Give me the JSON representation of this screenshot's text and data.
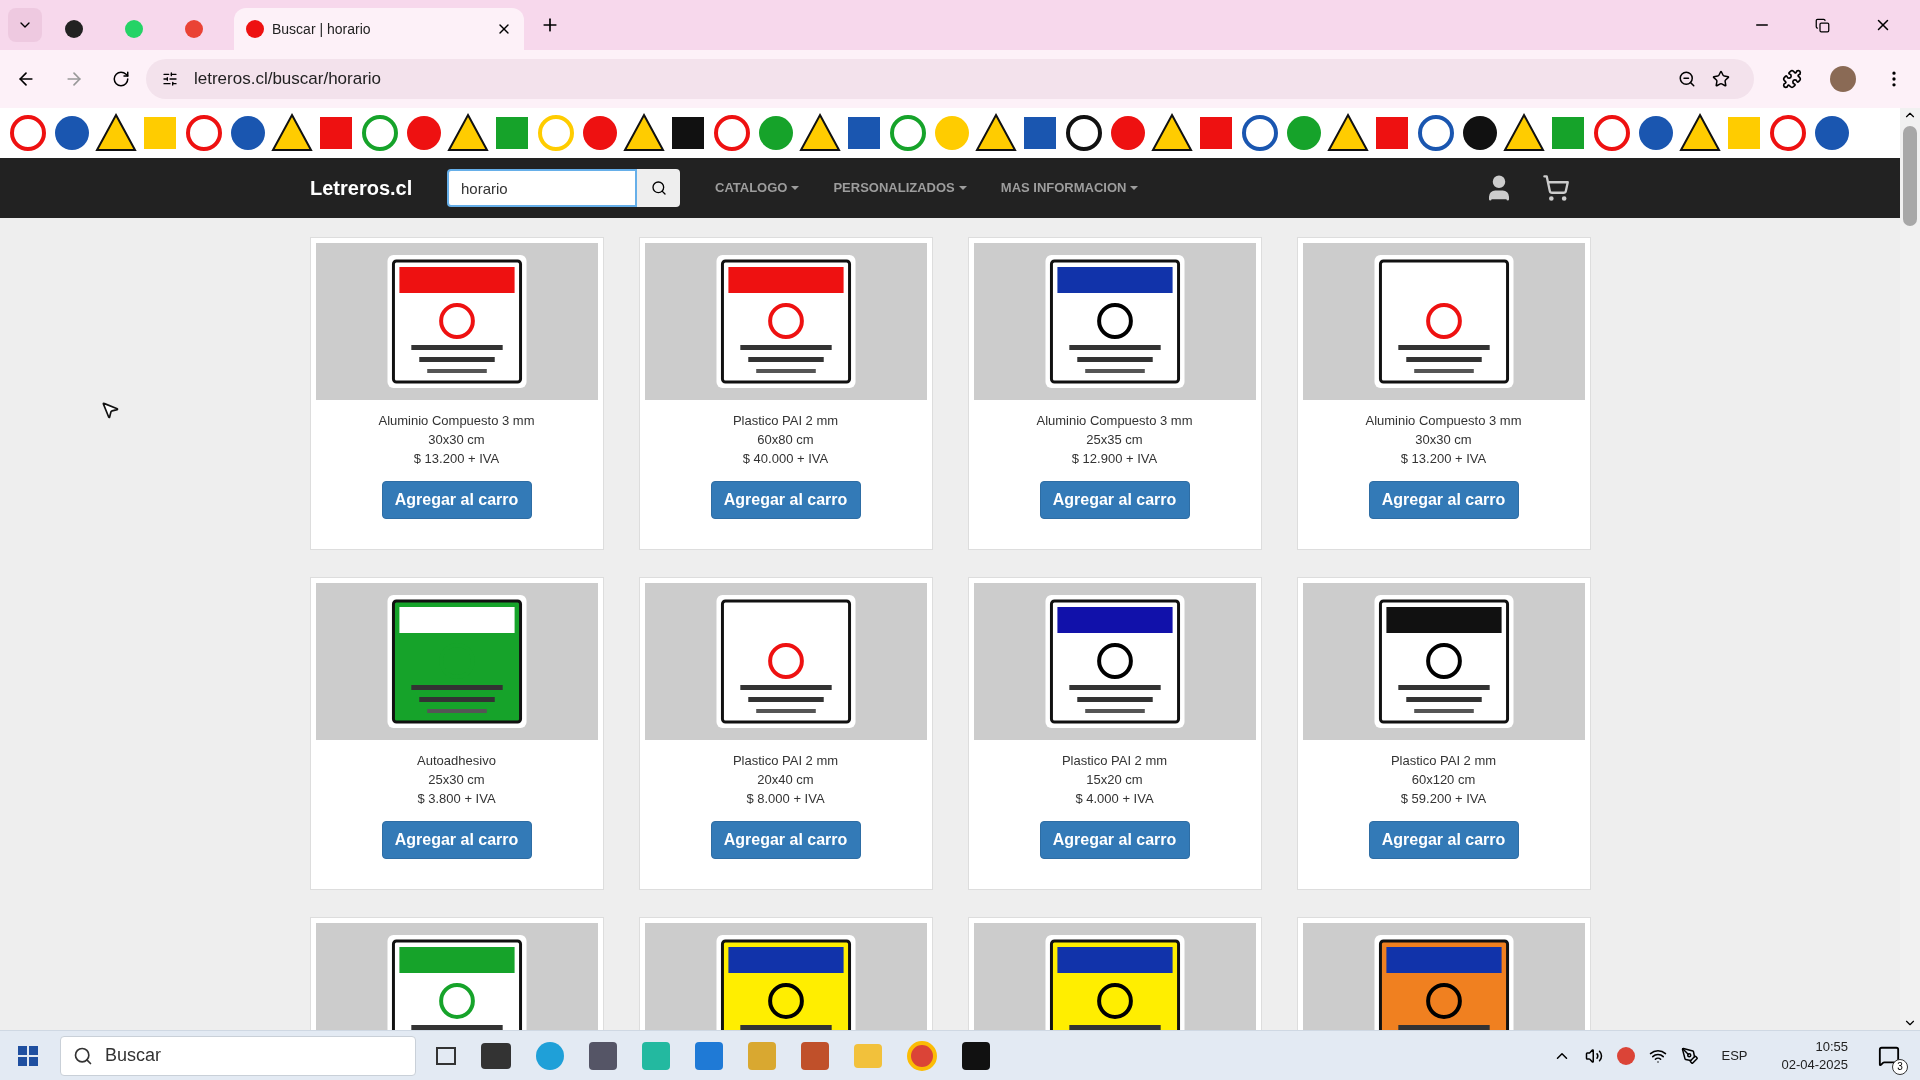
{
  "browser": {
    "tabs": [
      {
        "kind": "pinned",
        "selected": false
      },
      {
        "kind": "pinned",
        "selected": false
      },
      {
        "kind": "pinned",
        "selected": false
      },
      {
        "kind": "normal",
        "title": "Buscar | horario",
        "selected": true
      }
    ],
    "address": "letreros.cl/buscar/horario"
  },
  "navbar": {
    "brand": "Letreros.cl",
    "search": {
      "value": "horario"
    },
    "menus": [
      "CATALOGO",
      "PERSONALIZADOS",
      "MAS INFORMACION"
    ]
  },
  "products": [
    {
      "kind": "full",
      "material": "Aluminio Compuesto 3 mm",
      "size": "30x30 cm",
      "price": "$ 13.200 + IVA",
      "button": "Agregar al carro"
    },
    {
      "kind": "full",
      "material": "Plastico PAI 2 mm",
      "size": "60x80 cm",
      "price": "$ 40.000 + IVA",
      "button": "Agregar al carro"
    },
    {
      "kind": "full",
      "material": "Aluminio Compuesto 3 mm",
      "size": "25x35 cm",
      "price": "$ 12.900 + IVA",
      "button": "Agregar al carro"
    },
    {
      "kind": "full",
      "material": "Aluminio Compuesto 3 mm",
      "size": "30x30 cm",
      "price": "$ 13.200 + IVA",
      "button": "Agregar al carro"
    },
    {
      "kind": "full",
      "material": "Autoadhesivo",
      "size": "25x30 cm",
      "price": "$ 3.800 + IVA",
      "button": "Agregar al carro"
    },
    {
      "kind": "full",
      "material": "Plastico PAI 2 mm",
      "size": "20x40 cm",
      "price": "$ 8.000 + IVA",
      "button": "Agregar al carro"
    },
    {
      "kind": "full",
      "material": "Plastico PAI 2 mm",
      "size": "15x20 cm",
      "price": "$ 4.000 + IVA",
      "button": "Agregar al carro"
    },
    {
      "kind": "full",
      "material": "Plastico PAI 2 mm",
      "size": "60x120 cm",
      "price": "$ 59.200 + IVA",
      "button": "Agregar al carro"
    },
    {
      "kind": "image_only"
    },
    {
      "kind": "image_only"
    },
    {
      "kind": "image_only"
    },
    {
      "kind": "image_only"
    }
  ],
  "taskbar": {
    "search": "Buscar",
    "language": "ESP",
    "time": "10:55",
    "date": "02-04-2025",
    "notifications": "3"
  }
}
